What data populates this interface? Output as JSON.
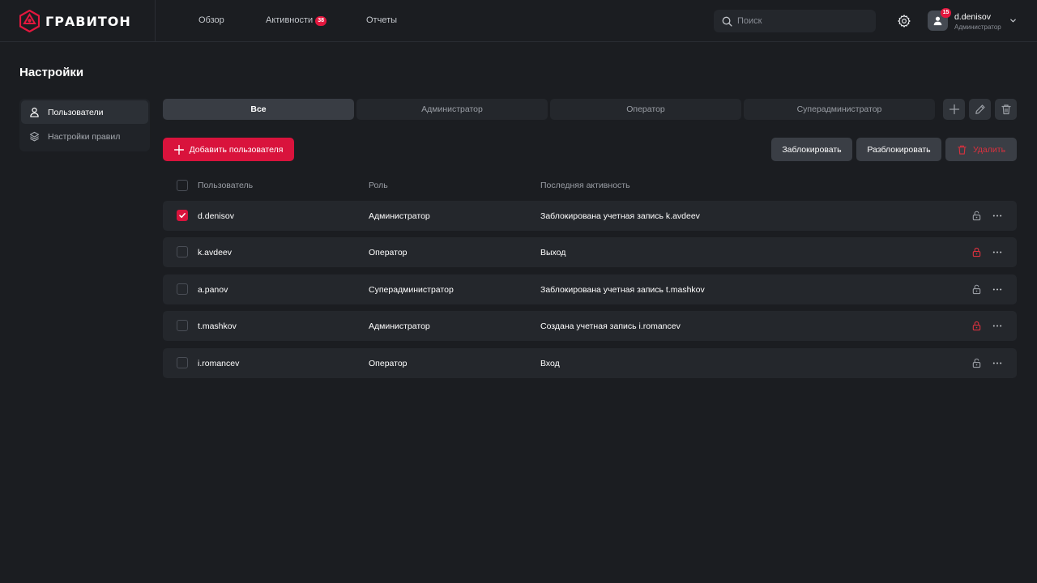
{
  "header": {
    "brand": "ГРАВИТОН",
    "nav": [
      {
        "label": "Обзор"
      },
      {
        "label": "Активности",
        "badge": "38"
      },
      {
        "label": "Отчеты"
      }
    ],
    "search_placeholder": "Поиск",
    "user": {
      "name": "d.denisov",
      "role": "Администратор",
      "badge": "15"
    }
  },
  "page": {
    "title": "Настройки"
  },
  "sidebar": {
    "items": [
      {
        "label": "Пользователи",
        "icon": "user-icon",
        "active": true
      },
      {
        "label": "Настройки правил",
        "icon": "layers-icon",
        "active": false
      }
    ]
  },
  "tabs": [
    {
      "label": "Все",
      "active": true
    },
    {
      "label": "Администратор",
      "active": false
    },
    {
      "label": "Оператор",
      "active": false
    },
    {
      "label": "Суперадминистратор",
      "active": false
    }
  ],
  "actions": {
    "add_user": "Добавить пользователя",
    "block": "Заблокировать",
    "unblock": "Разблокировать",
    "delete": "Удалить"
  },
  "table": {
    "headers": {
      "user": "Пользователь",
      "role": "Роль",
      "activity": "Последняя активность"
    },
    "rows": [
      {
        "user": "d.denisov",
        "role": "Администратор",
        "activity": "Заблокирована учетная запись k.avdeev",
        "checked": true,
        "locked": false
      },
      {
        "user": "k.avdeev",
        "role": "Оператор",
        "activity": "Выход",
        "checked": false,
        "locked": true
      },
      {
        "user": "a.panov",
        "role": "Суперадминистратор",
        "activity": "Заблокирована учетная запись t.mashkov",
        "checked": false,
        "locked": false
      },
      {
        "user": "t.mashkov",
        "role": "Администратор",
        "activity": "Создана учетная запись i.romancev",
        "checked": false,
        "locked": true
      },
      {
        "user": "i.romancev",
        "role": "Оператор",
        "activity": "Вход",
        "checked": false,
        "locked": false
      }
    ]
  },
  "colors": {
    "accent": "#d9133c",
    "background": "#1b1d21",
    "surface": "#24272c",
    "locked": "#d9313e",
    "unlocked": "#9a9ea5"
  }
}
